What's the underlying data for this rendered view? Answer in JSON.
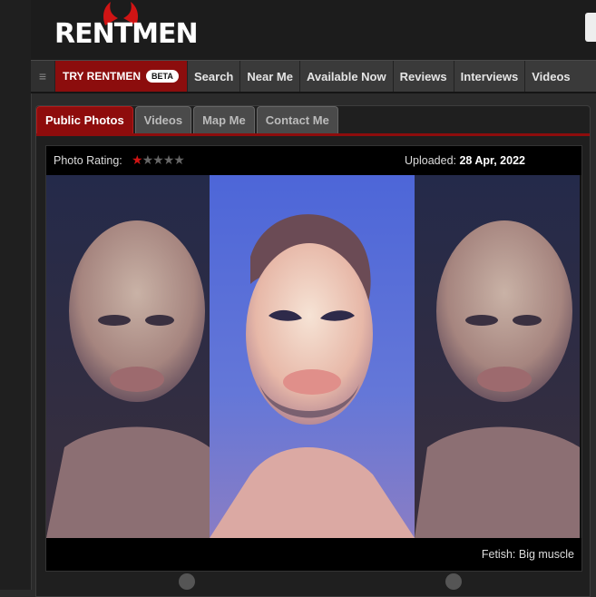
{
  "header": {
    "logo_text": "RENTMEN"
  },
  "navbar": {
    "menu_icon": "hamburger-icon",
    "try_label": "TRY RENTMEN",
    "beta_badge": "BETA",
    "items": [
      {
        "label": "Search"
      },
      {
        "label": "Near Me"
      },
      {
        "label": "Available Now"
      },
      {
        "label": "Reviews"
      },
      {
        "label": "Interviews"
      },
      {
        "label": "Videos"
      }
    ]
  },
  "tabs": [
    {
      "label": "Public Photos",
      "active": true
    },
    {
      "label": "Videos"
    },
    {
      "label": "Map Me"
    },
    {
      "label": "Contact Me"
    }
  ],
  "photo": {
    "rating_label": "Photo Rating:",
    "rating_stars_filled": 1,
    "rating_stars_total": 5,
    "uploaded_label": "Uploaded:",
    "uploaded_date": "28 Apr, 2022",
    "fetish_label": "Fetish:",
    "fetish_value": "Big muscle"
  },
  "actions": {
    "share_icon": "share-icon",
    "message_icon": "envelope-icon"
  },
  "colors": {
    "brand_red": "#8e0c0c",
    "background": "#2b2b2b"
  }
}
